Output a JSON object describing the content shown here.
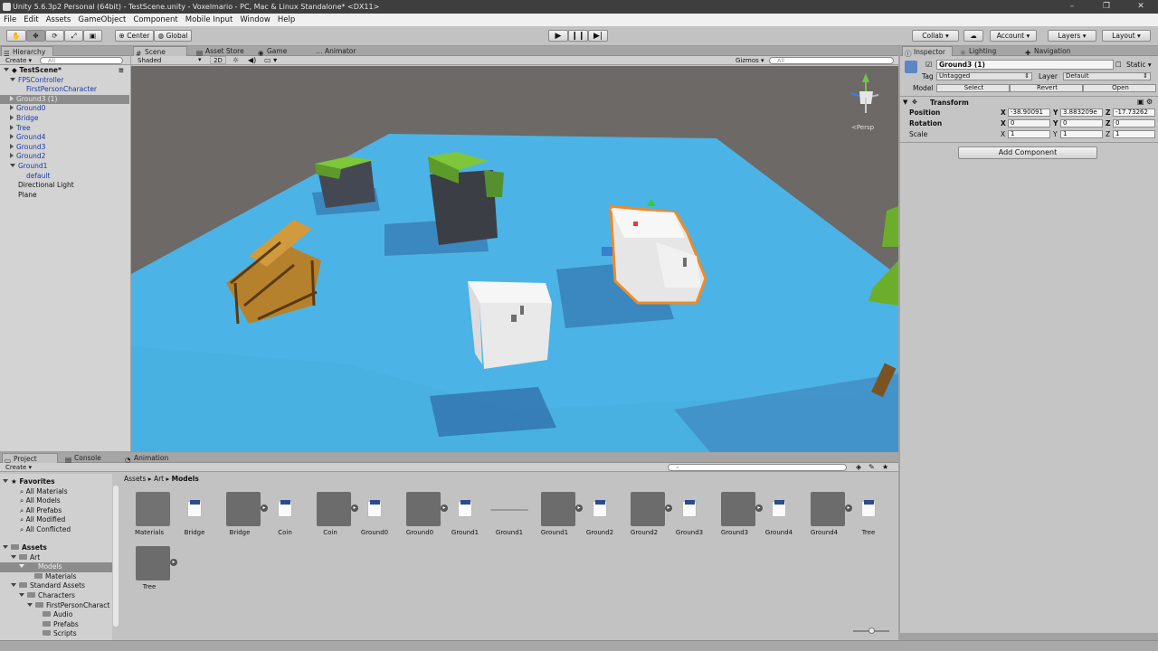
{
  "window": {
    "title": "Unity 5.6.3p2 Personal (64bit) - TestScene.unity - Voxelmario - PC, Mac & Linux Standalone* <DX11>",
    "controls": [
      "–",
      "❐",
      "✕"
    ]
  },
  "menu": [
    "File",
    "Edit",
    "Assets",
    "GameObject",
    "Component",
    "Mobile Input",
    "Window",
    "Help"
  ],
  "toolbar": {
    "pivot": "Center",
    "space": "Global",
    "collab": "Collab ▾",
    "account": "Account",
    "layers": "Layers",
    "layout": "Layout"
  },
  "hierarchy": {
    "tab": "Hierarchy",
    "create": "Create ▾",
    "search_placeholder": "All",
    "items": [
      {
        "label": "TestScene*"
      },
      {
        "label": "FPSController"
      },
      {
        "label": "FirstPersonCharacter"
      },
      {
        "label": "Ground3 (1)"
      },
      {
        "label": "Ground0"
      },
      {
        "label": "Bridge"
      },
      {
        "label": "Tree"
      },
      {
        "label": "Ground4"
      },
      {
        "label": "Ground3"
      },
      {
        "label": "Ground2"
      },
      {
        "label": "Ground1"
      },
      {
        "label": "default"
      },
      {
        "label": "Directional Light"
      },
      {
        "label": "Plane"
      }
    ]
  },
  "scene": {
    "tabs": [
      "Scene",
      "Asset Store",
      "Game",
      "Animator"
    ],
    "shading": "Shaded",
    "mode_2d": "2D",
    "gizmos": "Gizmos ▾",
    "search_placeholder": "All",
    "persp": "<Persp",
    "colors": {
      "water": "#4cb3e6",
      "sky": "#6c6966"
    }
  },
  "inspector": {
    "tabs": [
      "Inspector",
      "Lighting",
      "Navigation"
    ],
    "object_name": "Ground3 (1)",
    "static": "Static ▾",
    "tag_label": "Tag",
    "tag_value": "Untagged",
    "layer_label": "Layer",
    "layer_value": "Default",
    "model_label": "Model",
    "model_buttons": [
      "Select",
      "Revert",
      "Open"
    ],
    "transform_title": "Transform",
    "rows": [
      {
        "label": "Position",
        "x": "-38.90091",
        "y": "3.883209e",
        "z": "-17.73262"
      },
      {
        "label": "Rotation",
        "x": "0",
        "y": "0",
        "z": "0"
      },
      {
        "label": "Scale",
        "x": "1",
        "y": "1",
        "z": "1"
      }
    ],
    "axis": [
      "X",
      "Y",
      "Z"
    ],
    "add_component": "Add Component"
  },
  "bottom": {
    "tabs": [
      "Project",
      "Console",
      "Animation"
    ],
    "create": "Create ▾",
    "breadcrumb": [
      "Assets",
      "Art",
      "Models"
    ],
    "favorites_title": "Favorites",
    "favorites": [
      "All Materials",
      "All Models",
      "All Prefabs",
      "All Modified",
      "All Conflicted"
    ],
    "assets_title": "Assets",
    "tree": [
      "Art",
      "Models",
      "Materials",
      "Standard Assets",
      "Characters",
      "FirstPersonCharact",
      "Audio",
      "Prefabs",
      "Scripts"
    ],
    "assets": [
      {
        "name": "Materials",
        "kind": "folder"
      },
      {
        "name": "Bridge",
        "kind": "file"
      },
      {
        "name": "Bridge",
        "kind": "model"
      },
      {
        "name": "Coin",
        "kind": "file"
      },
      {
        "name": "Coin",
        "kind": "model"
      },
      {
        "name": "Ground0",
        "kind": "file"
      },
      {
        "name": "Ground0",
        "kind": "model"
      },
      {
        "name": "Ground1",
        "kind": "file"
      },
      {
        "name": "Ground1",
        "kind": "line"
      },
      {
        "name": "Ground1",
        "kind": "model"
      },
      {
        "name": "Ground2",
        "kind": "file"
      },
      {
        "name": "Ground2",
        "kind": "model"
      },
      {
        "name": "Ground3",
        "kind": "file"
      },
      {
        "name": "Ground3",
        "kind": "model"
      },
      {
        "name": "Ground4",
        "kind": "file"
      },
      {
        "name": "Ground4",
        "kind": "model"
      },
      {
        "name": "Tree",
        "kind": "file"
      },
      {
        "name": "Tree",
        "kind": "model"
      }
    ]
  }
}
